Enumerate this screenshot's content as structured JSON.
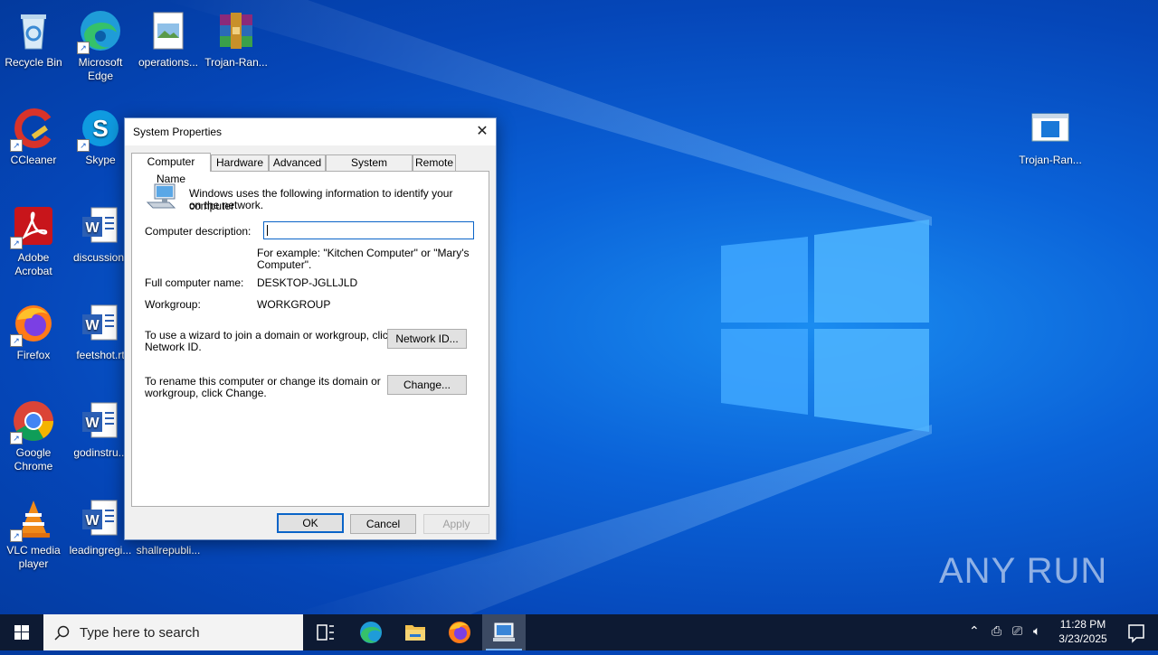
{
  "desktop": {
    "icons": [
      {
        "label": "Recycle Bin"
      },
      {
        "label": "Microsoft Edge"
      },
      {
        "label": "operations..."
      },
      {
        "label": "Trojan-Ran..."
      },
      {
        "label": "CCleaner"
      },
      {
        "label": "Skype"
      },
      {
        "label": "Adobe Acrobat"
      },
      {
        "label": "discussionr"
      },
      {
        "label": "Firefox"
      },
      {
        "label": "feetshot.rt"
      },
      {
        "label": "Google Chrome"
      },
      {
        "label": "godinstru..."
      },
      {
        "label": "VLC media player"
      },
      {
        "label": "leadingregi..."
      },
      {
        "label": "shallrepubli..."
      },
      {
        "label": "Trojan-Ran..."
      }
    ],
    "watermark": "ANY RUN"
  },
  "dialog": {
    "title": "System Properties",
    "tabs": [
      "Computer Name",
      "Hardware",
      "Advanced",
      "System Protection",
      "Remote"
    ],
    "intro_line1": "Windows uses the following information to identify your computer",
    "intro_line2": "on the network.",
    "desc_label": "Computer description:",
    "desc_value": "",
    "example_line1": "For example: \"Kitchen Computer\" or \"Mary's",
    "example_line2": "Computer\".",
    "fullname_label": "Full computer name:",
    "fullname_value": "DESKTOP-JGLLJLD",
    "workgroup_label": "Workgroup:",
    "workgroup_value": "WORKGROUP",
    "wizard_line1": "To use a wizard to join a domain or workgroup, click",
    "wizard_line2": "Network ID.",
    "network_id_button": "Network ID...",
    "rename_line1": "To rename this computer or change its domain or",
    "rename_line2": "workgroup, click Change.",
    "change_button": "Change...",
    "ok_button": "OK",
    "cancel_button": "Cancel",
    "apply_button": "Apply"
  },
  "taskbar": {
    "search_placeholder": "Type here to search",
    "time": "11:28 PM",
    "date": "3/23/2025"
  }
}
